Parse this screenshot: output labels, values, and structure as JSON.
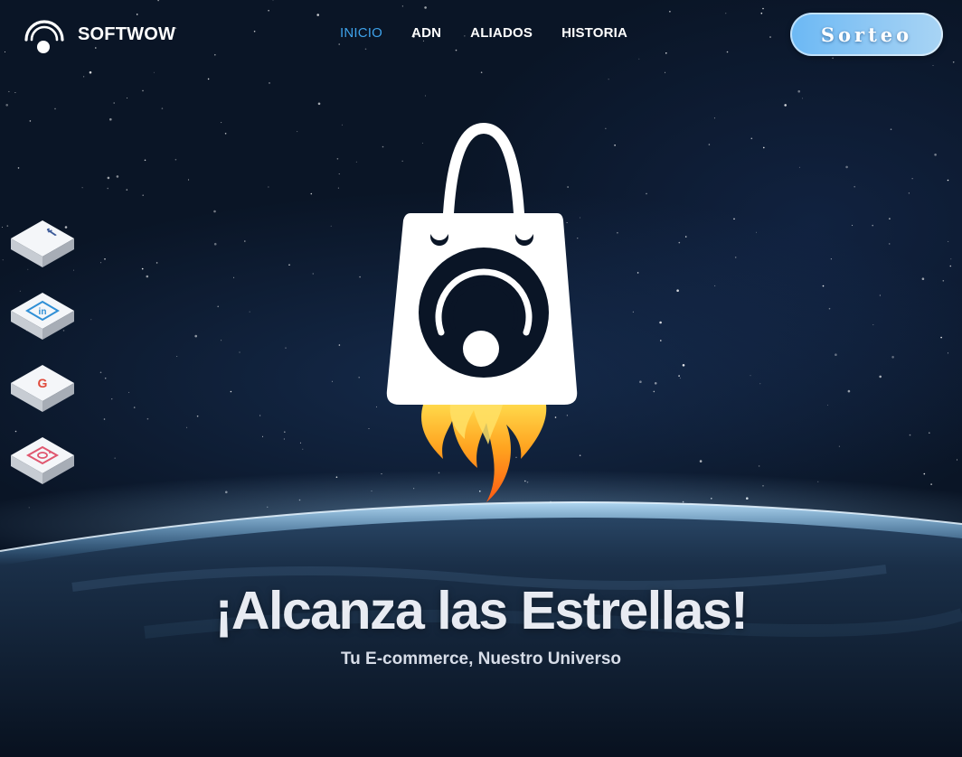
{
  "brand": {
    "name": "SOFTWOW",
    "logo_icon": "softwow-logo-icon"
  },
  "nav": {
    "items": [
      {
        "label": "INICIO",
        "active": true
      },
      {
        "label": "ADN",
        "active": false
      },
      {
        "label": "ALIADOS",
        "active": false
      },
      {
        "label": "HISTORIA",
        "active": false
      }
    ]
  },
  "cta": {
    "label": "Sorteo"
  },
  "social": [
    {
      "icon": "facebook-icon",
      "color": "#3b5998"
    },
    {
      "icon": "linkedin-icon",
      "color": "#2f8fd6"
    },
    {
      "icon": "google-icon",
      "color": "#e04a3b"
    },
    {
      "icon": "instagram-icon",
      "color": "#e0566f"
    }
  ],
  "hero": {
    "art_icon": "shopping-bag-rocket-icon",
    "title": "¡Alcanza las Estrellas!",
    "subtitle": "Tu E-commerce, Nuestro Universo"
  },
  "colors": {
    "background": "#0a1526",
    "nav_active": "#3ea2ea",
    "cta_gradient_start": "#6bb8f4",
    "cta_gradient_end": "#a8d4f4",
    "flame_outer": "#ff6a1a",
    "flame_inner": "#ffcc33"
  }
}
